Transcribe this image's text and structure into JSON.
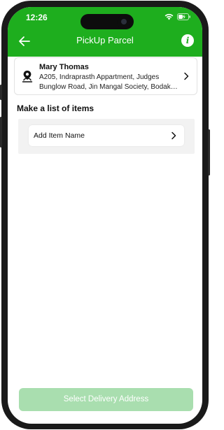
{
  "status_bar": {
    "time": "12:26"
  },
  "header": {
    "title": "PickUp Parcel"
  },
  "address_card": {
    "name": "Mary Thomas",
    "line1": "A205, Indraprasth Appartment, Judges",
    "line2": "Bunglow Road, Jin Mangal Society, Bodakd..."
  },
  "items_section": {
    "title": "Make a list of items",
    "add_item_label": "Add Item Name"
  },
  "footer": {
    "cta_label": "Select Delivery Address"
  },
  "colors": {
    "brand_green": "#1eae1e",
    "cta_disabled": "#a9deaf"
  },
  "icons": [
    "back-arrow-icon",
    "info-icon",
    "location-pin-icon",
    "chevron-right-icon",
    "wifi-icon",
    "battery-icon"
  ]
}
